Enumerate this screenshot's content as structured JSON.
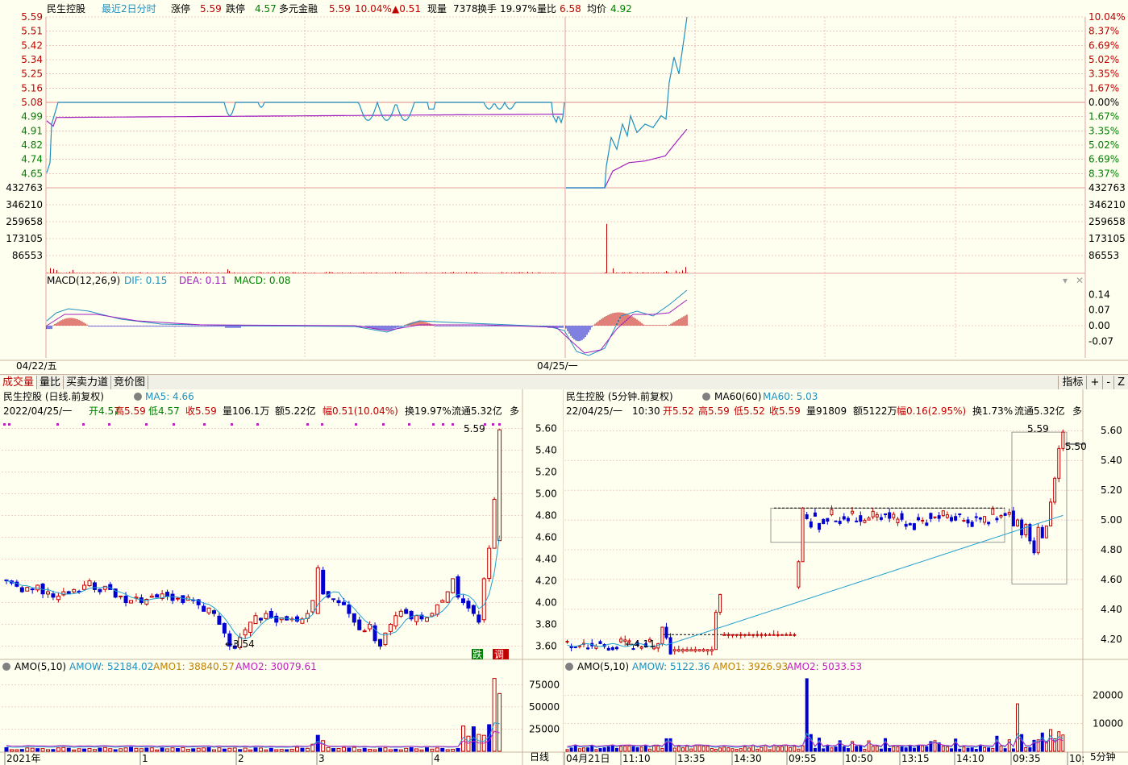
{
  "colors": {
    "up": "#c00000",
    "down": "#008000",
    "grid": "#e6a0a0",
    "price_line": "#2090c0",
    "avg_line": "#a020c0",
    "vol_bar": "#c00000",
    "blue": "#0000d0",
    "cyan": "#20a0d0",
    "magenta": "#c020c0"
  },
  "intraday": {
    "header": {
      "name": "民生控股",
      "mode": "最近2日分时",
      "limit_up_label": "涨停",
      "limit_up": "5.59",
      "limit_down_label": "跌停",
      "limit_down": "4.57",
      "tag": "多元金融",
      "price": "5.59",
      "pct": "10.04%",
      "change": "▲0.51",
      "cur_vol_label": "现量",
      "cur_vol": "7378",
      "turnover_label": "换手",
      "turnover": "19.97%",
      "vol_ratio_label": "量比",
      "vol_ratio": "6.58",
      "avg_label": "均价",
      "avg": "4.92"
    },
    "price_axis_left": [
      "5.59",
      "5.51",
      "5.42",
      "5.34",
      "5.25",
      "5.16",
      "5.08",
      "4.99",
      "4.91",
      "4.82",
      "4.74",
      "4.65"
    ],
    "price_axis_right": [
      "10.04%",
      "8.37%",
      "6.69%",
      "5.02%",
      "3.35%",
      "1.67%",
      "0.00%",
      "1.67%",
      "3.35%",
      "5.02%",
      "6.69%",
      "8.37%"
    ],
    "vol_axis": [
      "432763",
      "346210",
      "259658",
      "173105",
      "86553"
    ],
    "macd_header": {
      "label": "MACD(12,26,9)",
      "dif": "DIF: 0.15",
      "dea": "DEA: 0.11",
      "macd": "MACD: 0.08"
    },
    "macd_axis": [
      "0.14",
      "0.07",
      "0.00",
      "-0.07"
    ],
    "dates": [
      "04/22/五",
      "04/25/一"
    ]
  },
  "tabs": [
    "成交量",
    "量比",
    "买卖力道",
    "竞价图"
  ],
  "tab_right": [
    "指标",
    "+",
    "-",
    "Z"
  ],
  "daily": {
    "title": "民生控股 (日线.前复权)",
    "ma_label": "MA5: 4.66",
    "info": {
      "date": "2022/04/25/一",
      "open": "开4.57",
      "high": "高5.59",
      "low": "低4.57",
      "close": "收5.59",
      "vol": "量106.1万",
      "amt": "额5.22亿",
      "amp": "幅0.51(10.04%)",
      "turn": "换19.97%",
      "float": "流通5.32亿",
      "more": "多"
    },
    "axis": [
      "5.60",
      "5.40",
      "5.20",
      "5.00",
      "4.80",
      "4.60",
      "4.40",
      "4.20",
      "4.00",
      "3.80",
      "3.60"
    ],
    "hi_label": "5.59",
    "lo_label": "←3.54",
    "badges": [
      "跌",
      "调"
    ],
    "amo_header": {
      "label": "AMO(5,10)",
      "amow": "AMOW: 52184.02",
      "amo1": "AMO1: 38840.57",
      "amo2": "AMO2: 30079.61"
    },
    "amo_axis": [
      "75000",
      "50000",
      "25000"
    ],
    "x_labels": [
      "2021年",
      "1",
      "2",
      "3",
      "4"
    ],
    "period": "日线"
  },
  "min5": {
    "title": "民生控股 (5分钟.前复权)",
    "ma_label": "MA60(60)",
    "ma_value": "MA60: 5.03",
    "info": {
      "date": "22/04/25/一",
      "time": "10:30",
      "open": "开5.52",
      "high": "高5.59",
      "low": "低5.52",
      "close": "收5.59",
      "vol": "量91809",
      "amt": "额5122万",
      "amp": "幅0.16(2.95%)",
      "turn": "换1.73%",
      "float": "流通5.32亿",
      "more": "多"
    },
    "axis": [
      "5.60",
      "5.40",
      "5.20",
      "5.00",
      "4.80",
      "4.60",
      "4.40",
      "4.20"
    ],
    "hi_label": "5.59",
    "lo_label": "←4.11",
    "last_label": "5.50",
    "amo_header": {
      "label": "AMO(5,10)",
      "amow": "AMOW: 5122.36",
      "amo1": "AMO1: 3926.93",
      "amo2": "AMO2: 5033.53"
    },
    "amo_axis": [
      "20000",
      "10000"
    ],
    "x_labels": [
      "04月21日",
      "11:10",
      "13:35",
      "14:30",
      "09:55",
      "10:50",
      "13:15",
      "14:10",
      "09:35",
      "10:"
    ],
    "period": "5分钟"
  },
  "chart_data": [
    {
      "type": "line",
      "title": "民生控股 最近2日分时",
      "xlabel": "",
      "ylabel": "",
      "ylim": [
        4.57,
        5.59
      ],
      "x": [
        "04/22",
        "04/22",
        "04/22",
        "04/22",
        "04/22",
        "04/22",
        "04/22",
        "04/22",
        "04/25",
        "04/25",
        "04/25",
        "04/25",
        "04/25",
        "04/25",
        "04/25",
        "04/25",
        "04/25"
      ],
      "series": [
        {
          "name": "",
          "values": [
            4.65,
            5.08,
            5.08,
            5.08,
            5.08,
            5.08,
            5.04,
            5.06,
            4.65,
            4.83,
            4.88,
            4.93,
            4.98,
            5.05,
            5.25,
            5.42,
            5.59
          ]
        }
      ]
    },
    {
      "type": "bar",
      "title": "民生控股 (日线.前复权)",
      "ylim": [
        3.54,
        5.59
      ],
      "categories": [
        "2021-12",
        "2022-01",
        "2022-02",
        "2022-03",
        "2022-04"
      ],
      "values": [
        4.15,
        4.0,
        3.85,
        3.9,
        5.59
      ]
    },
    {
      "type": "bar",
      "title": "民生控股 (5分钟.前复权)",
      "ylim": [
        4.11,
        5.59
      ],
      "categories": [
        "04/21 10:30",
        "04/21 11:10",
        "04/21 13:35",
        "04/21 14:30",
        "04/22 09:55",
        "04/22 10:50",
        "04/22 13:15",
        "04/22 14:10",
        "04/25 09:35",
        "04/25 10:30"
      ],
      "values": [
        4.15,
        4.13,
        4.23,
        4.23,
        5.08,
        5.04,
        5.02,
        5.06,
        4.9,
        5.59
      ]
    }
  ]
}
